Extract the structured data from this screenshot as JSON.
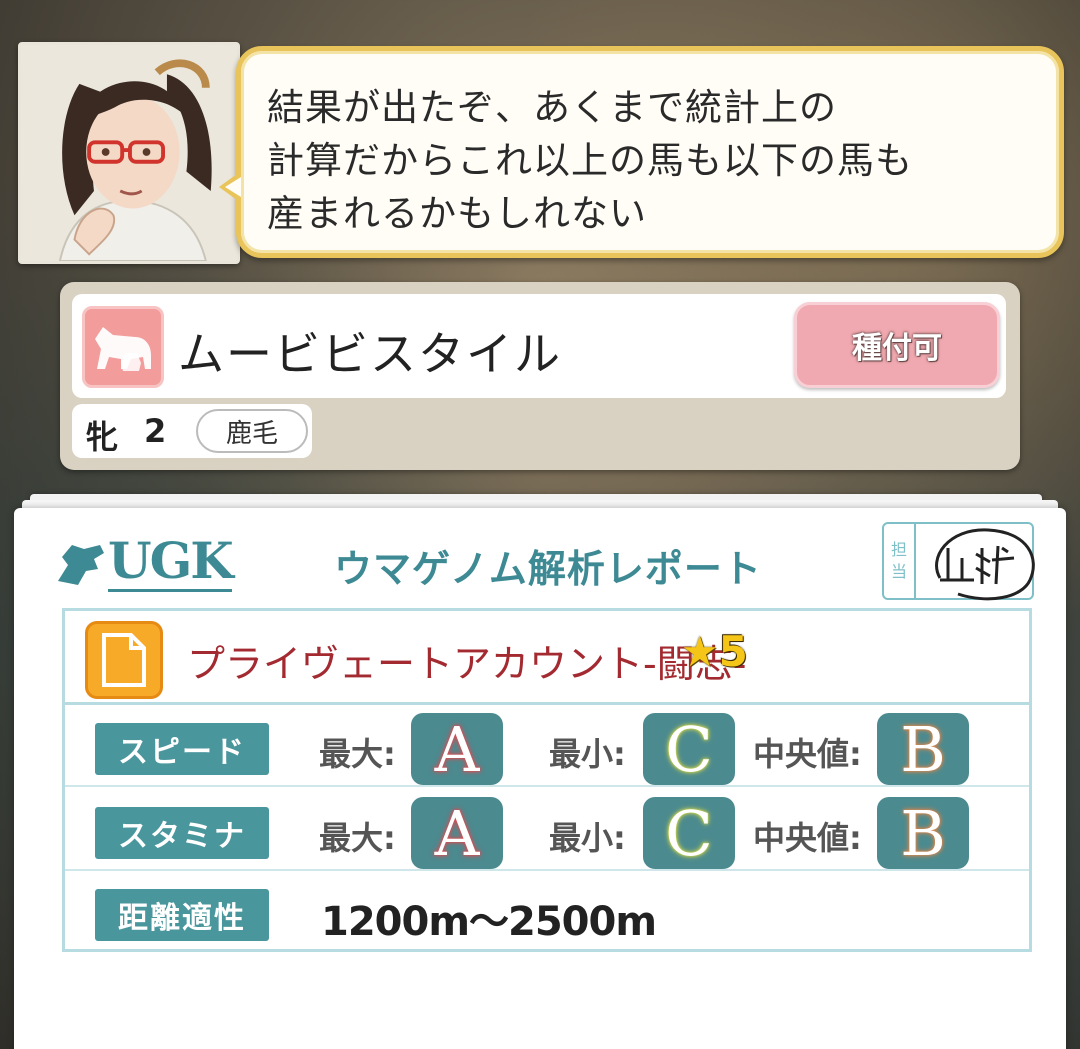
{
  "dialog": {
    "lines": [
      "結果が出たぞ、あくまで統計上の",
      "計算だからこれ以上の馬も以下の馬も",
      "産まれるかもしれない"
    ]
  },
  "horse": {
    "name": "ムービビスタイル",
    "breed_button": "種付可",
    "sex": "牝",
    "age": "2",
    "coat": "鹿毛",
    "icon": "horse-mare-icon"
  },
  "report": {
    "logo": "UGK",
    "title": "ウマゲノム解析レポート",
    "stamp_label": [
      "担",
      "当"
    ],
    "stamp_signature": "山科",
    "analysis_name": "プライヴェートアカウント-闘志-",
    "star_glyph": "★",
    "stars": "5",
    "stats": [
      {
        "label": "スピード",
        "max_label": "最大:",
        "max": "A",
        "min_label": "最小:",
        "min": "C",
        "median_label": "中央値:",
        "median": "B"
      },
      {
        "label": "スタミナ",
        "max_label": "最大:",
        "max": "A",
        "min_label": "最小:",
        "min": "C",
        "median_label": "中央値:",
        "median": "B"
      }
    ],
    "distance": {
      "label": "距離適性",
      "value": "1200m〜2500m"
    }
  },
  "colors": {
    "accent_teal": "#4a969d",
    "bubble_border": "#e8c45a",
    "grade_A_glow": "#e04a50",
    "grade_B_glow": "#e0874a",
    "grade_C_glow": "#d6d84a",
    "analysis_name": "#a32a30",
    "breed_button": "#f0a9b0"
  }
}
